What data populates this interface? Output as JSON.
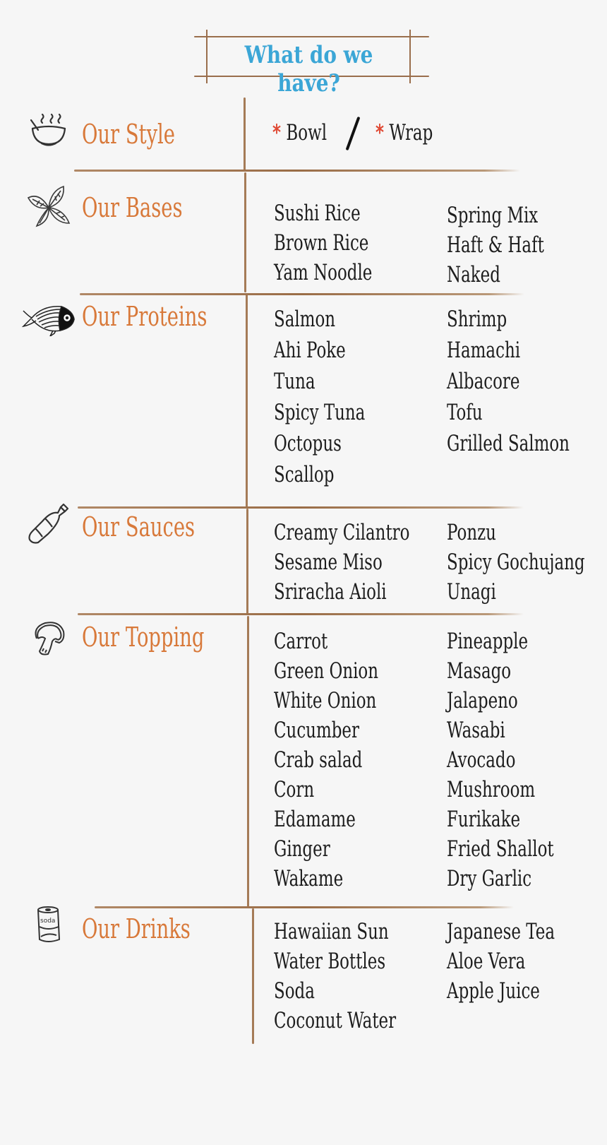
{
  "title": "What do we have?",
  "colors": {
    "title": "#3ba6d6",
    "section_label": "#d8793a",
    "item_text": "#1d1d1d",
    "asterisk": "#e04a35",
    "divider": "#9a6d47",
    "background": "#f6f6f6"
  },
  "style": {
    "label": "Our Style",
    "icon": "soup-bowl-icon",
    "options": [
      "Bowl",
      "Wrap"
    ],
    "bullet": "*"
  },
  "sections": [
    {
      "label": "Our Bases",
      "icon": "basil-leaf-icon",
      "col1": [
        "Sushi Rice",
        "Brown Rice",
        "Yam Noodle"
      ],
      "col2": [
        "Spring Mix",
        "Haft & Haft",
        "Naked"
      ]
    },
    {
      "label": "Our Proteins",
      "icon": "fish-icon",
      "col1": [
        "Salmon",
        "Ahi Poke",
        "Tuna",
        "Spicy Tuna",
        "Octopus",
        "Scallop"
      ],
      "col2": [
        "Shrimp",
        "Hamachi",
        "Albacore",
        "Tofu",
        "Grilled Salmon"
      ]
    },
    {
      "label": "Our Sauces",
      "icon": "sauce-bottle-icon",
      "col1": [
        "Creamy Cilantro",
        "Sesame Miso",
        "Sriracha Aioli"
      ],
      "col2": [
        "Ponzu",
        "Spicy Gochujang",
        "Unagi"
      ]
    },
    {
      "label": "Our Topping",
      "icon": "mushroom-icon",
      "col1": [
        "Carrot",
        "Green Onion",
        "White Onion",
        "Cucumber",
        "Crab salad",
        "Corn",
        "Edamame",
        "Ginger",
        "Wakame"
      ],
      "col2": [
        "Pineapple",
        "Masago",
        "Jalapeno",
        "Wasabi",
        "Avocado",
        "Mushroom",
        "Furikake",
        "Fried Shallot",
        "Dry Garlic"
      ]
    },
    {
      "label": "Our Drinks",
      "icon": "soda-can-icon",
      "icon_text": "soda",
      "col1": [
        "Hawaiian Sun",
        "Water Bottles",
        "Soda",
        "Coconut Water"
      ],
      "col2": [
        "Japanese Tea",
        "Aloe Vera",
        "Apple Juice"
      ]
    }
  ]
}
